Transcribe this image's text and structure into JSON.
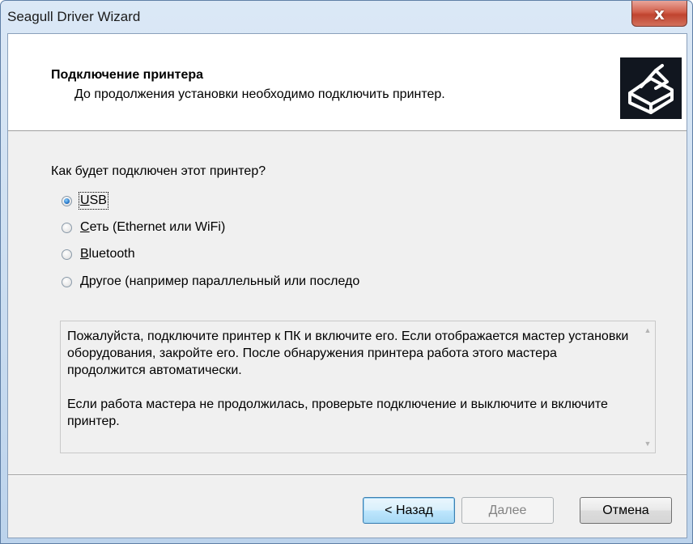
{
  "window": {
    "title": "Seagull Driver Wizard",
    "close_glyph": "x"
  },
  "header": {
    "title": "Подключение принтера",
    "subtitle": "До продолжения установки необходимо подключить принтер.",
    "logo_icon": "printer-logo-icon"
  },
  "question": "Как будет подключен этот принтер?",
  "options": [
    {
      "prefix": "",
      "accel": "U",
      "rest": "SB",
      "selected": true
    },
    {
      "prefix": "",
      "accel": "С",
      "rest": "еть (Ethernet или WiFi)",
      "selected": false
    },
    {
      "prefix": "",
      "accel": "B",
      "rest": "luetooth",
      "selected": false
    },
    {
      "prefix": "",
      "accel": "Д",
      "rest": "ругое (например параллельный или последо",
      "selected": false
    }
  ],
  "info": {
    "paragraph1": "Пожалуйста, подключите принтер к ПК и включите его. Если отображается мастер установки оборудования, закройте его. После обнаружения принтера работа этого мастера продолжится автоматически.",
    "paragraph2": "Если работа мастера не продолжилась, проверьте подключение и выключите и включите принтер.",
    "scroll_up_glyph": "▲",
    "scroll_down_glyph": "▼"
  },
  "buttons": {
    "back": "< Назад",
    "next": "Далее",
    "cancel": "Отмена"
  },
  "colors": {
    "selected_radio": "#2a78c8",
    "default_button_border": "#3c7fb1",
    "close_button": "#c0442f"
  }
}
